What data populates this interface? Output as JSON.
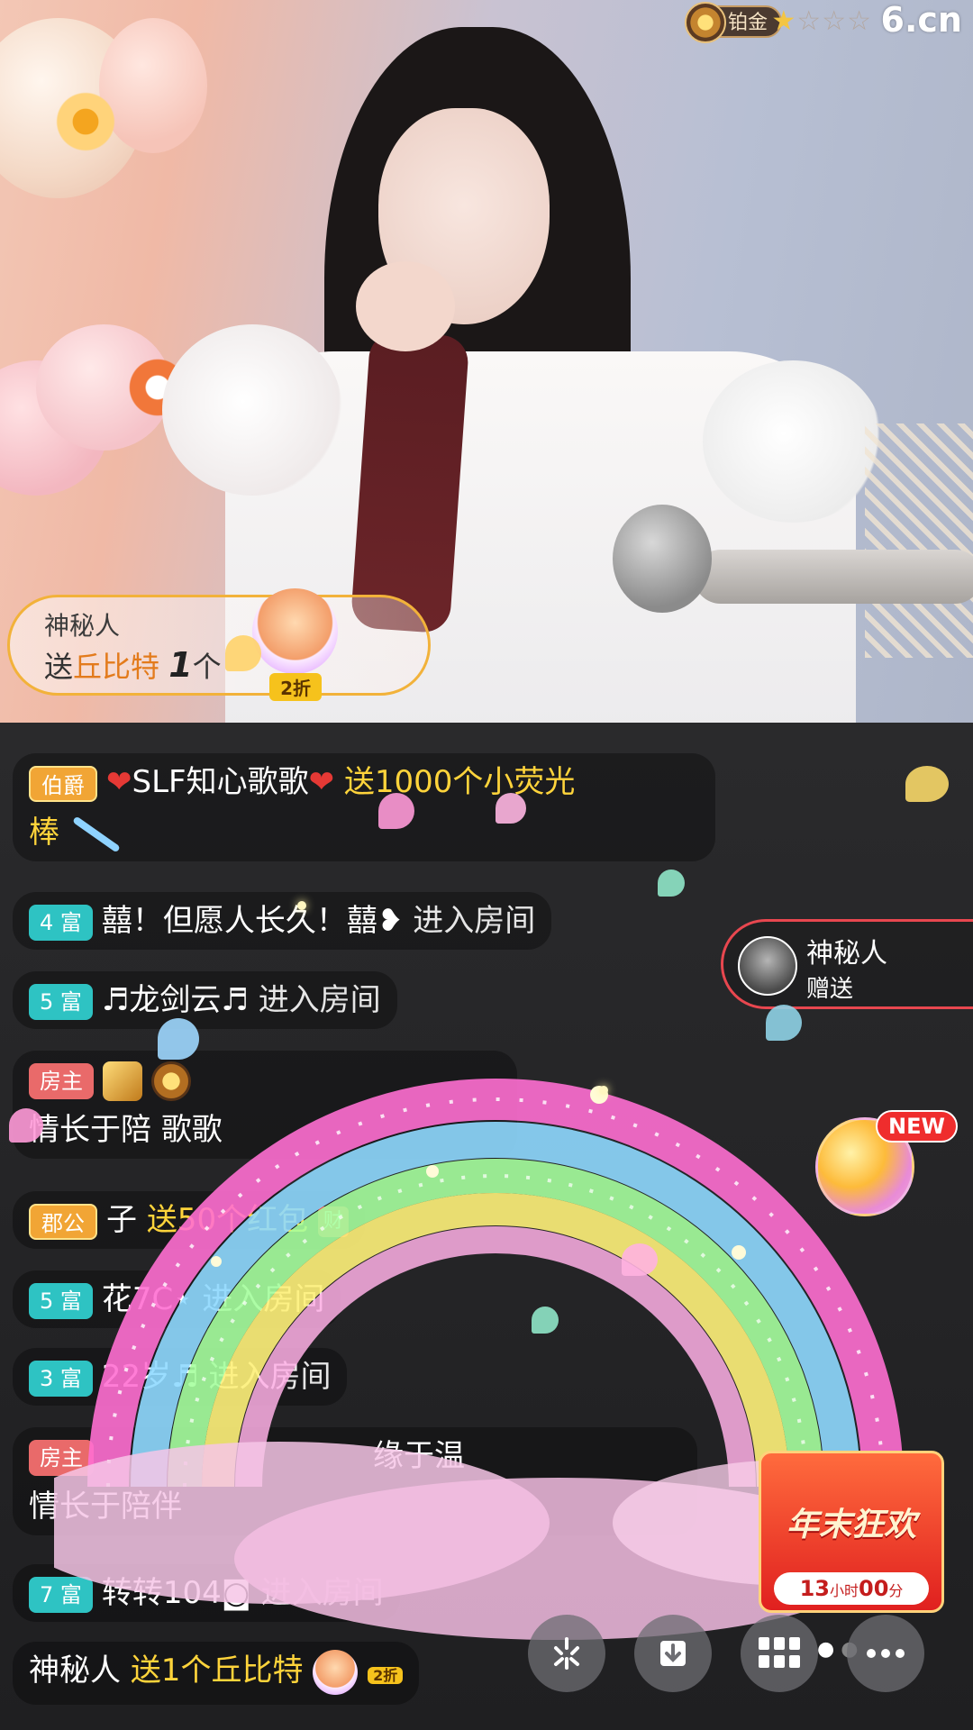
{
  "header": {
    "level_label": "铂金",
    "stars_on": 1,
    "stars_total": 4,
    "site_logo": "6.cn"
  },
  "gift_toast": {
    "sender": "神秘人",
    "send_word": "送",
    "gift_name": "丘比特",
    "count": "1",
    "unit": "个",
    "discount": "2折"
  },
  "side_toast": {
    "name": "神秘人",
    "action": "赠送"
  },
  "chat": [
    {
      "tag": "伯爵",
      "text_a": "SLF知心歌歌",
      "text_b": "送1000个小荧光",
      "text_c": "棒"
    },
    {
      "tag": "4 富",
      "text": "囍！但愿人长久！囍❥",
      "action": "进入房间"
    },
    {
      "tag": "5 富",
      "text": "♬龙剑云♬",
      "action": "进入房间"
    },
    {
      "tag": "房主",
      "text": "情长于陪",
      "text_b": "歌歌"
    },
    {
      "tag": "郡公",
      "text": "子",
      "action": "送50个红包",
      "icon": "财"
    },
    {
      "tag": "5 富",
      "text": "花7C⋆",
      "action": "进入房间"
    },
    {
      "tag": "3 富",
      "text": "22岁♬",
      "action": "进入房间"
    },
    {
      "tag": "房主",
      "text_b": "缘于温",
      "text": "情长于陪伴"
    },
    {
      "tag": "7 富",
      "text": "转转104◙",
      "action": "进入房间"
    },
    {
      "name": "神秘人",
      "action": "送1个丘比特",
      "discount": "2折"
    }
  ],
  "promo": {
    "new_label": "NEW",
    "title": "年末狂欢",
    "hours": "13",
    "hours_unit": "小时",
    "minutes": "00",
    "minutes_unit": "分"
  },
  "buttons": [
    {
      "name": "share-button",
      "icon": "sparkle-icon"
    },
    {
      "name": "download-button",
      "icon": "download-icon"
    },
    {
      "name": "grid-menu-button",
      "icon": "grid-icon"
    },
    {
      "name": "more-button",
      "icon": "more-icon"
    }
  ]
}
